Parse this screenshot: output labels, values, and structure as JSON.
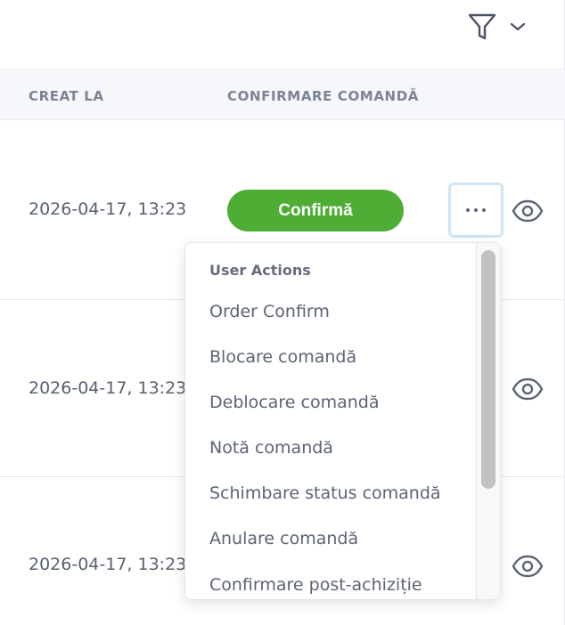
{
  "toolbar": {
    "filter_icon": "funnel-icon",
    "dropdown_icon": "chevron-down-icon"
  },
  "table": {
    "columns": {
      "created_at": "CREAT LA",
      "order_confirmation": "CONFIRMARE COMANDĂ"
    },
    "rows": [
      {
        "created_at": "2026-04-17, 13:23",
        "confirm_label": "Confirmă",
        "more_icon": "ellipsis-icon",
        "view_icon": "eye-icon"
      },
      {
        "created_at": "2026-04-17, 13:23",
        "view_icon": "eye-icon"
      },
      {
        "created_at": "2026-04-17, 13:23",
        "view_icon": "eye-icon"
      }
    ]
  },
  "actions_menu": {
    "heading": "User Actions",
    "items": [
      "Order Confirm",
      "Blocare comandă",
      "Deblocare comandă",
      "Notă comandă",
      "Schimbare status comandă",
      "Anulare comandă",
      "Confirmare post-achiziție"
    ]
  },
  "colors": {
    "confirm_button": "#4ead35",
    "focus_ring": "#cfe6f6",
    "header_background": "#f5f7fa",
    "text": "#586070"
  }
}
